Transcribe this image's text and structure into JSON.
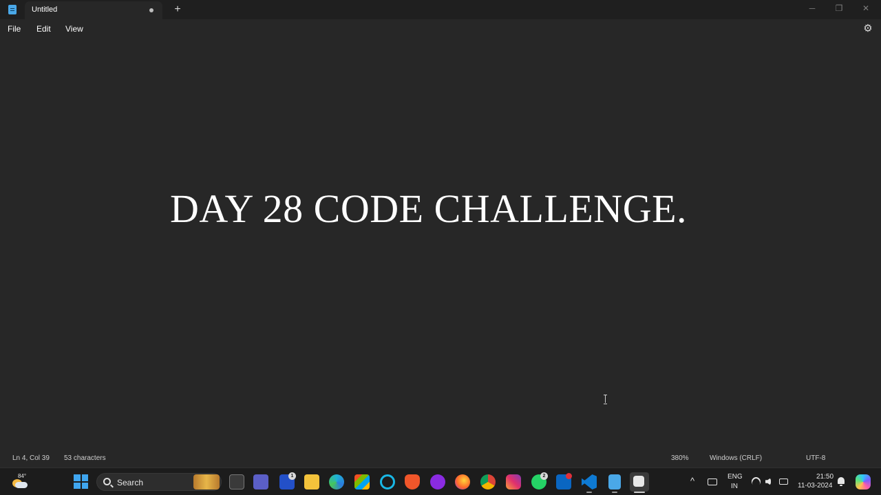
{
  "window": {
    "tab_title": "Untitled",
    "new_tab_symbol": "+",
    "minimize_symbol": "─",
    "maximize_symbol": "❐",
    "close_symbol": "✕"
  },
  "menu": {
    "file": "File",
    "edit": "Edit",
    "view": "View",
    "settings_symbol": "⚙"
  },
  "document": {
    "text": "DAY 28 CODE CHALLENGE."
  },
  "status": {
    "position": "Ln 4, Col 39",
    "characters": "53 characters",
    "zoom": "380%",
    "line_endings": "Windows (CRLF)",
    "encoding": "UTF-8"
  },
  "taskbar": {
    "weather_temp": "84°",
    "search_label": "Search",
    "lens_badge": "1",
    "whatsapp_badge": "2",
    "accent": "#3fa6f0"
  },
  "tray": {
    "chevron_symbol": "^",
    "language_line1": "ENG",
    "language_line2": "IN",
    "time": "21:50",
    "date": "11-03-2024"
  }
}
